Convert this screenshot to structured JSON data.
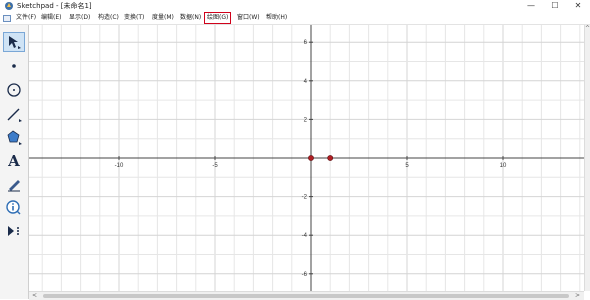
{
  "window": {
    "title": "Sketchpad - [未命名1]",
    "minimize_glyph": "—",
    "maximize_glyph": "☐",
    "close_glyph": "✕"
  },
  "menu": [
    {
      "label": "文件(F)"
    },
    {
      "label": "编辑(E)"
    },
    {
      "label": "显示(D)"
    },
    {
      "label": "构造(C)"
    },
    {
      "label": "变换(T)"
    },
    {
      "label": "度量(M)"
    },
    {
      "label": "数据(N)"
    },
    {
      "label": "绘图(G)",
      "highlighted": true
    },
    {
      "label": "窗口(W)"
    },
    {
      "label": "帮助(H)"
    }
  ],
  "toolbox": [
    {
      "name": "arrow-tool-icon",
      "selected": true
    },
    {
      "name": "point-tool-icon"
    },
    {
      "name": "compass-tool-icon"
    },
    {
      "name": "straightedge-tool-icon"
    },
    {
      "name": "polygon-tool-icon"
    },
    {
      "name": "text-tool-icon",
      "glyph": "A"
    },
    {
      "name": "marker-tool-icon"
    },
    {
      "name": "information-tool-icon"
    },
    {
      "name": "custom-tool-icon"
    }
  ],
  "graph": {
    "x_ticks": [
      -10,
      -5,
      5,
      10
    ],
    "y_ticks": [
      6,
      4,
      2,
      -2,
      -4,
      -6
    ],
    "point_color": "#b01e23",
    "points": [
      {
        "x": 0,
        "y": 0
      },
      {
        "x": 1,
        "y": 0
      }
    ]
  },
  "scroll_glyphs": {
    "left": "<",
    "right": ">",
    "up": "^",
    "down": "v"
  }
}
